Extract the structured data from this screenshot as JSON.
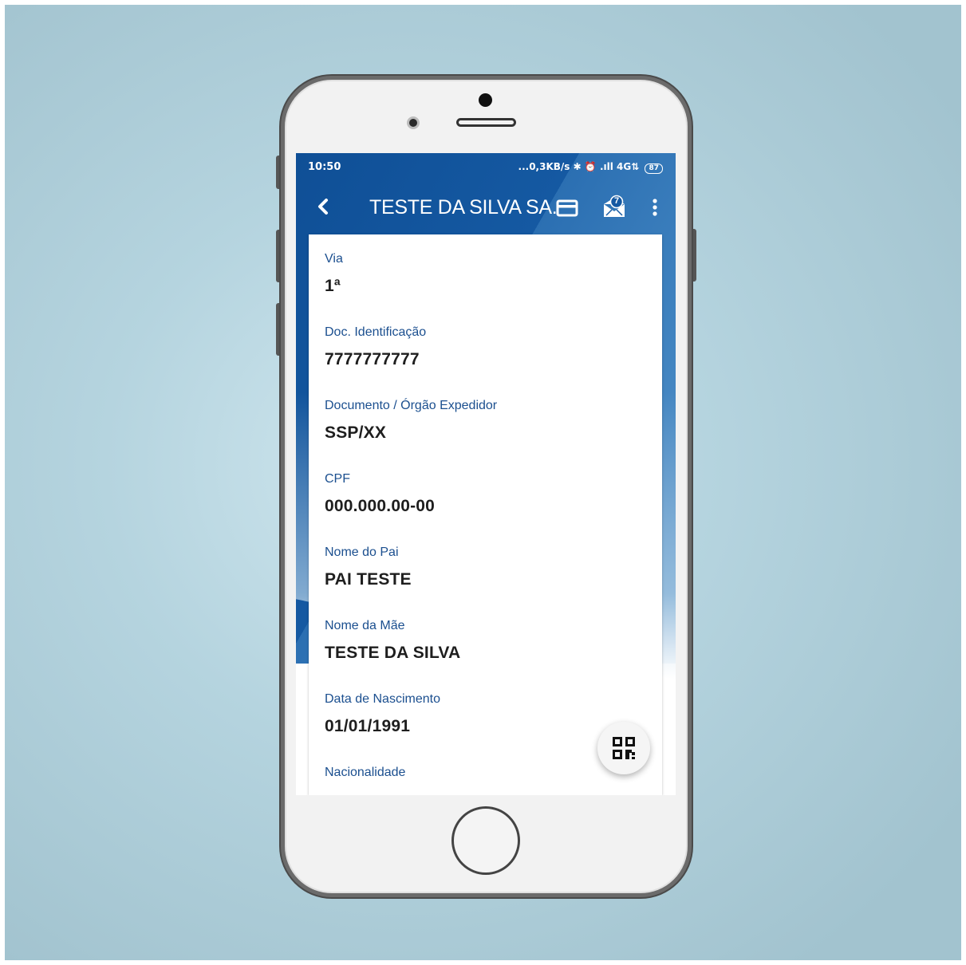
{
  "status_bar": {
    "time": "10:50",
    "indicators": "...0,3KB/s ✱ ⏰ .ıll 4G⇅",
    "battery": "87"
  },
  "app_bar": {
    "title": "TESTE DA SILVA SA...",
    "back_icon": "chevron-left-icon",
    "card_icon": "card-icon",
    "mail_icon": "mail-icon",
    "mail_badge": "7",
    "more_icon": "more-vert-icon"
  },
  "fields": [
    {
      "label": "Via",
      "value": "1ª"
    },
    {
      "label": "Doc. Identificação",
      "value": "7777777777"
    },
    {
      "label": "Documento / Órgão Expedidor",
      "value": "SSP/XX"
    },
    {
      "label": "CPF",
      "value": "000.000.00-00"
    },
    {
      "label": "Nome do Pai",
      "value": "PAI TESTE"
    },
    {
      "label": "Nome da Mãe",
      "value": "TESTE DA SILVA"
    },
    {
      "label": "Data de Nascimento",
      "value": "01/01/1991"
    },
    {
      "label": "Nacionalidade",
      "value": ""
    }
  ],
  "fab": {
    "icon": "qr-code-icon"
  },
  "colors": {
    "primary": "#1559a2",
    "label": "#1b4f8f",
    "background": "#b5d4df"
  }
}
